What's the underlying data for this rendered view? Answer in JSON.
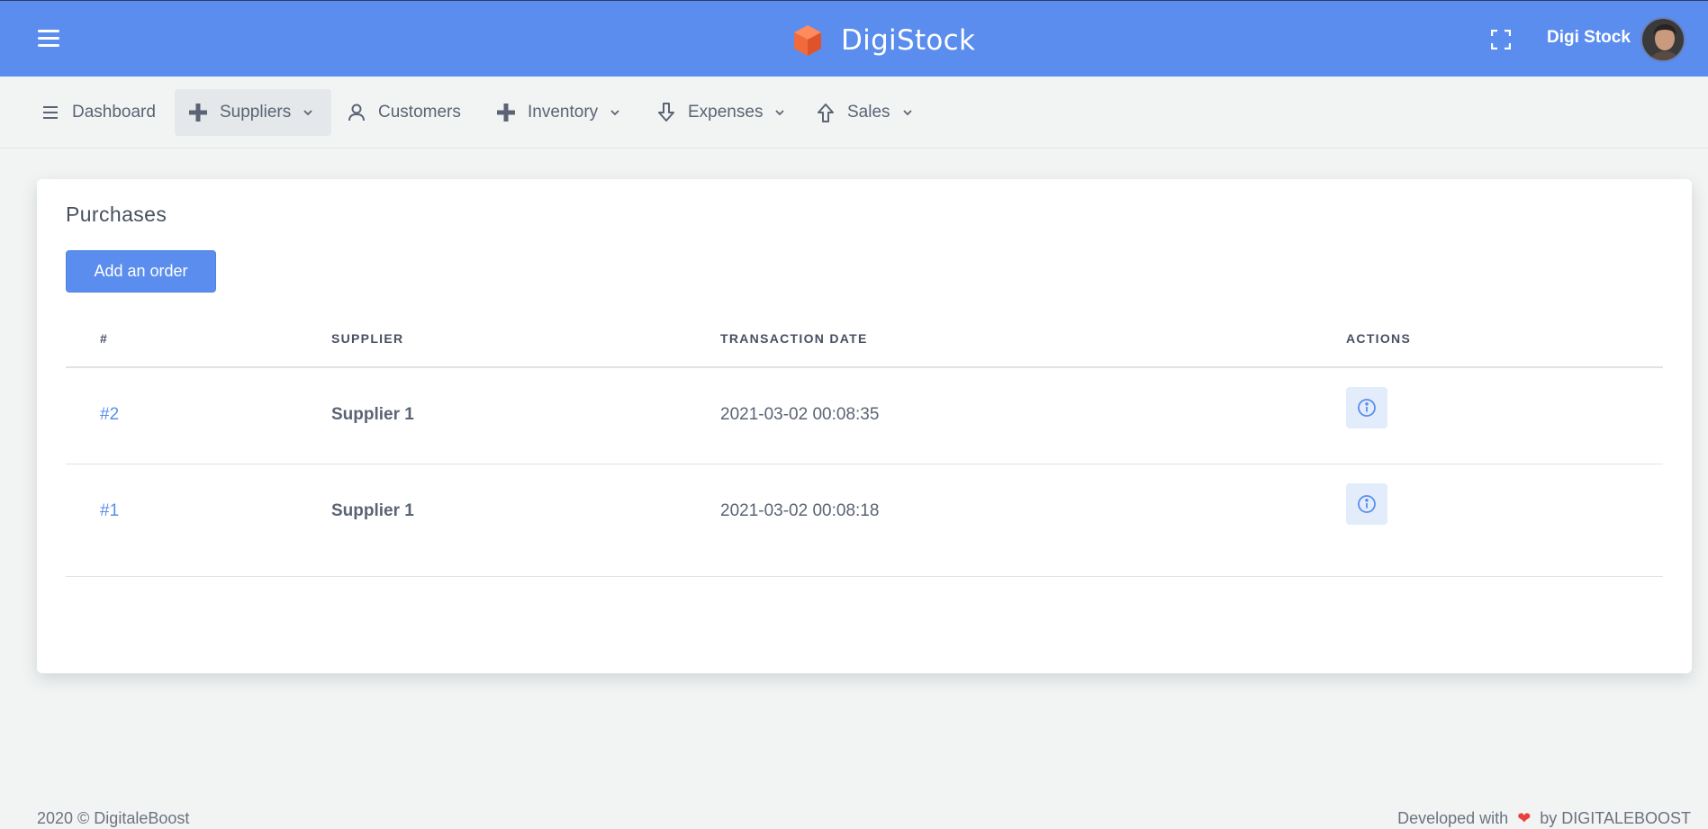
{
  "header": {
    "brand_name": "DigiStock",
    "user_name": "Digi Stock",
    "accent_color": "#5b8dee"
  },
  "nav": {
    "items": [
      {
        "label": "Dashboard",
        "icon": "menu-lines-icon",
        "dropdown": false
      },
      {
        "label": "Suppliers",
        "icon": "plus-icon",
        "dropdown": true,
        "active": true
      },
      {
        "label": "Customers",
        "icon": "user-icon",
        "dropdown": false
      },
      {
        "label": "Inventory",
        "icon": "plus-icon",
        "dropdown": true
      },
      {
        "label": "Expenses",
        "icon": "arrow-down-icon",
        "dropdown": true
      },
      {
        "label": "Sales",
        "icon": "arrow-up-icon",
        "dropdown": true
      }
    ]
  },
  "card": {
    "title": "Purchases",
    "add_button_label": "Add an order",
    "table": {
      "headers": [
        "#",
        "SUPPLIER",
        "TRANSACTION DATE",
        "ACTIONS"
      ],
      "rows": [
        {
          "id": "#2",
          "supplier": "Supplier 1",
          "date": "2021-03-02 00:08:35"
        },
        {
          "id": "#1",
          "supplier": "Supplier 1",
          "date": "2021-03-02 00:08:18"
        }
      ]
    }
  },
  "footer": {
    "copyright": "2020 © DigitaleBoost",
    "developed_prefix": "Developed with",
    "developed_suffix": "by DIGITALEBOOST",
    "heart_color": "#e8403d"
  }
}
